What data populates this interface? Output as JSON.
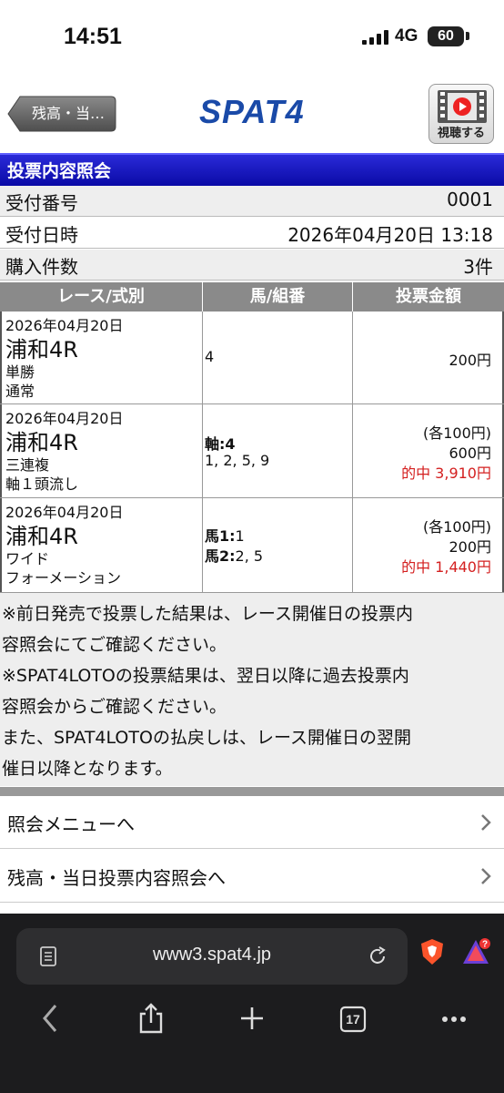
{
  "status_bar": {
    "time": "14:51",
    "network": "4G",
    "battery": "60"
  },
  "header": {
    "back_label": "残高・当…",
    "logo": "SPAT4",
    "watch_label": "視聴する"
  },
  "page_title": "投票内容照会",
  "info": [
    {
      "key": "受付番号",
      "value": "0001"
    },
    {
      "key": "受付日時",
      "value": "2026年04月20日  13:18"
    },
    {
      "key": "購入件数",
      "value": "3件"
    }
  ],
  "table": {
    "headers": [
      "レース/式別",
      "馬/組番",
      "投票金額"
    ],
    "rows": [
      {
        "date": "2026年04月20日",
        "venue": "浦和4R",
        "type1": "単勝",
        "type2": "通常",
        "horse_bold1": "",
        "horse_text1": "4",
        "horse_bold2": "",
        "horse_text2": "",
        "amount_each": "",
        "amount": "200円",
        "hit": ""
      },
      {
        "date": "2026年04月20日",
        "venue": "浦和4R",
        "type1": "三連複",
        "type2": "軸１頭流し",
        "horse_bold1": "軸:4",
        "horse_text1": "",
        "horse_bold2": "",
        "horse_text2": "1, 2, 5, 9",
        "amount_each": "(各100円)",
        "amount": "600円",
        "hit": "的中  3,910円"
      },
      {
        "date": "2026年04月20日",
        "venue": "浦和4R",
        "type1": "ワイド",
        "type2": "フォーメーション",
        "horse_bold1": "馬1:",
        "horse_text1": "1",
        "horse_bold2": "馬2:",
        "horse_text2": "2, 5",
        "amount_each": "(各100円)",
        "amount": "200円",
        "hit": "的中  1,440円"
      }
    ]
  },
  "notes": [
    "※前日発売で投票した結果は、レース開催日の投票内",
    "容照会にてご確認ください。",
    "※SPAT4LOTOの投票結果は、翌日以降に過去投票内",
    "容照会からご確認ください。",
    "また、SPAT4LOTOの払戻しは、レース開催日の翌開",
    "催日以降となります。"
  ],
  "menu": [
    {
      "label": "照会メニューへ"
    },
    {
      "label": "残高・当日投票内容照会へ"
    }
  ],
  "browser": {
    "url": "www3.spat4.jp",
    "tab_count": "17"
  },
  "colors": {
    "title_bar": "#0a0aa6",
    "hit_red": "#d42020",
    "logo_blue": "#1a4aa8",
    "table_header": "#8a8a8a"
  }
}
